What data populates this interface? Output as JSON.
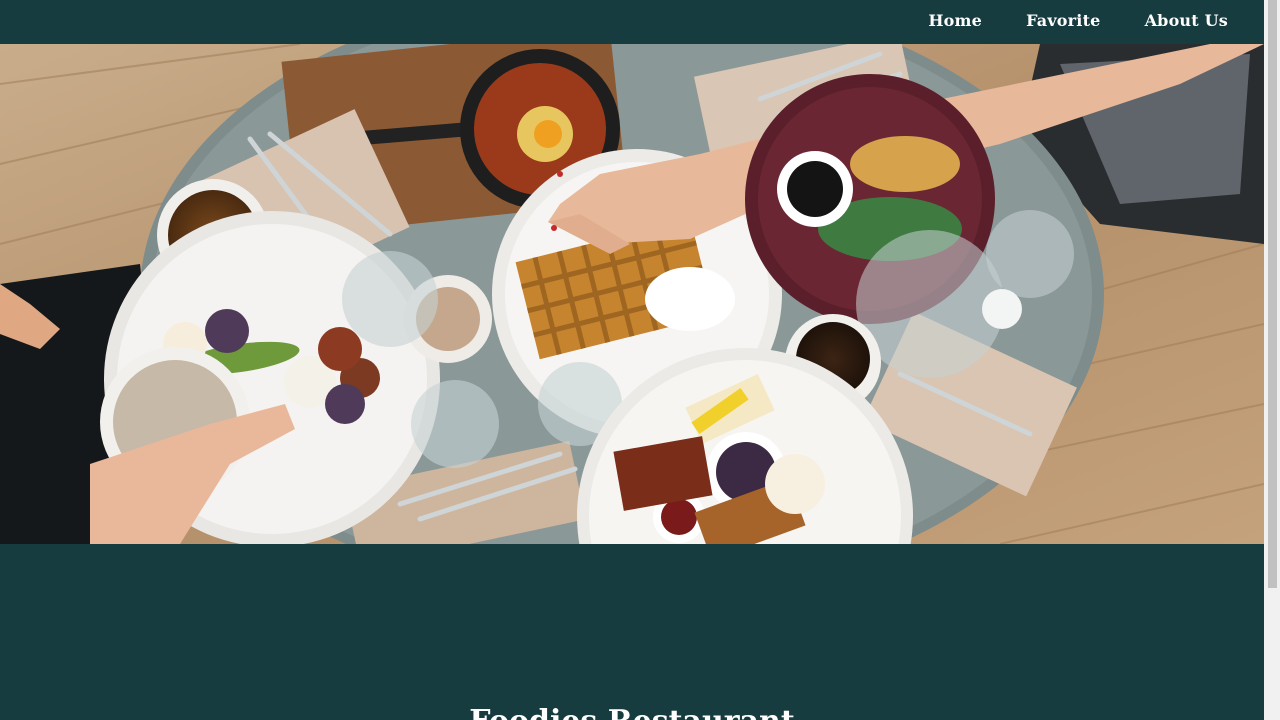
{
  "nav": {
    "items": [
      {
        "label": "Home"
      },
      {
        "label": "Favorite"
      },
      {
        "label": "About Us"
      }
    ]
  },
  "hero": {
    "image_alt": "Overhead photo of a breakfast table with waffles, coffee, and plates of food"
  },
  "main": {
    "heading": "Foodies Restaurant"
  },
  "colors": {
    "background": "#173c3f",
    "nav_text": "#ffffff"
  }
}
